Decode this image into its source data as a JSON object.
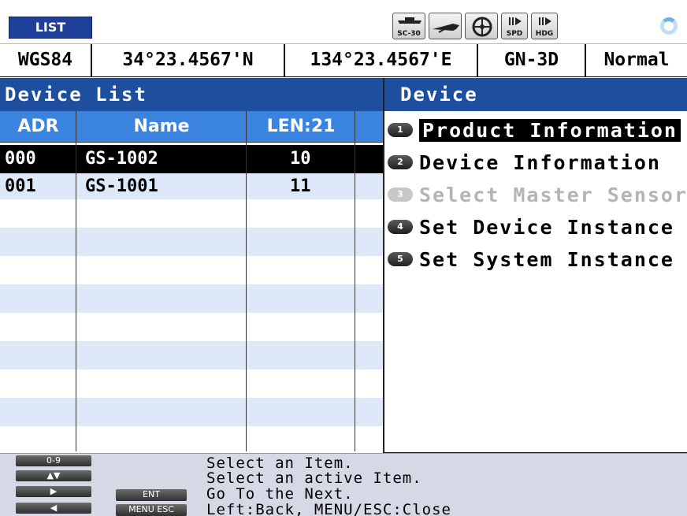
{
  "topbar": {
    "mode_label": "LIST",
    "status_icons": [
      {
        "name": "sc30-icon",
        "caption": "SC-30"
      },
      {
        "name": "vessel-icon",
        "caption": ""
      },
      {
        "name": "steering-wheel-icon",
        "caption": ""
      },
      {
        "name": "speed-icon",
        "caption": "SPD"
      },
      {
        "name": "heading-icon",
        "caption": "HDG"
      }
    ]
  },
  "position": {
    "datum": "WGS84",
    "latitude": "34°23.4567'N",
    "longitude": "134°23.4567'E",
    "fix_mode": "GN-3D",
    "status": "Normal"
  },
  "device_list": {
    "title": "Device List",
    "columns": {
      "adr": "ADR",
      "name": "Name",
      "len": "LEN:21"
    },
    "rows": [
      {
        "adr": "000",
        "name": "GS-1002",
        "len": "10"
      },
      {
        "adr": "001",
        "name": "GS-1001",
        "len": "11"
      }
    ]
  },
  "device_menu": {
    "title": "Device",
    "items": [
      {
        "num": "1",
        "label": "Product Information"
      },
      {
        "num": "2",
        "label": "Device Information"
      },
      {
        "num": "3",
        "label": "Select Master Sensor"
      },
      {
        "num": "4",
        "label": "Set Device Instance"
      },
      {
        "num": "5",
        "label": "Set System Instance"
      }
    ]
  },
  "help": {
    "keys": {
      "digits": "0-9",
      "updown": "▲▼",
      "right": "▶",
      "left": "◀",
      "ent": "ENT",
      "menu_esc": "MENU ESC"
    },
    "lines": [
      "Select an Item.",
      "Select an active Item.",
      "Go To the Next.",
      "Left:Back, MENU/ESC:Close"
    ]
  },
  "colors": {
    "title_bar": "#1e4f9e",
    "column_header": "#3a84e0",
    "row_alt": "#dde9f9",
    "selection": "#000000",
    "help_bar": "#d5d9e6",
    "disabled_text": "#b4b4b4"
  }
}
